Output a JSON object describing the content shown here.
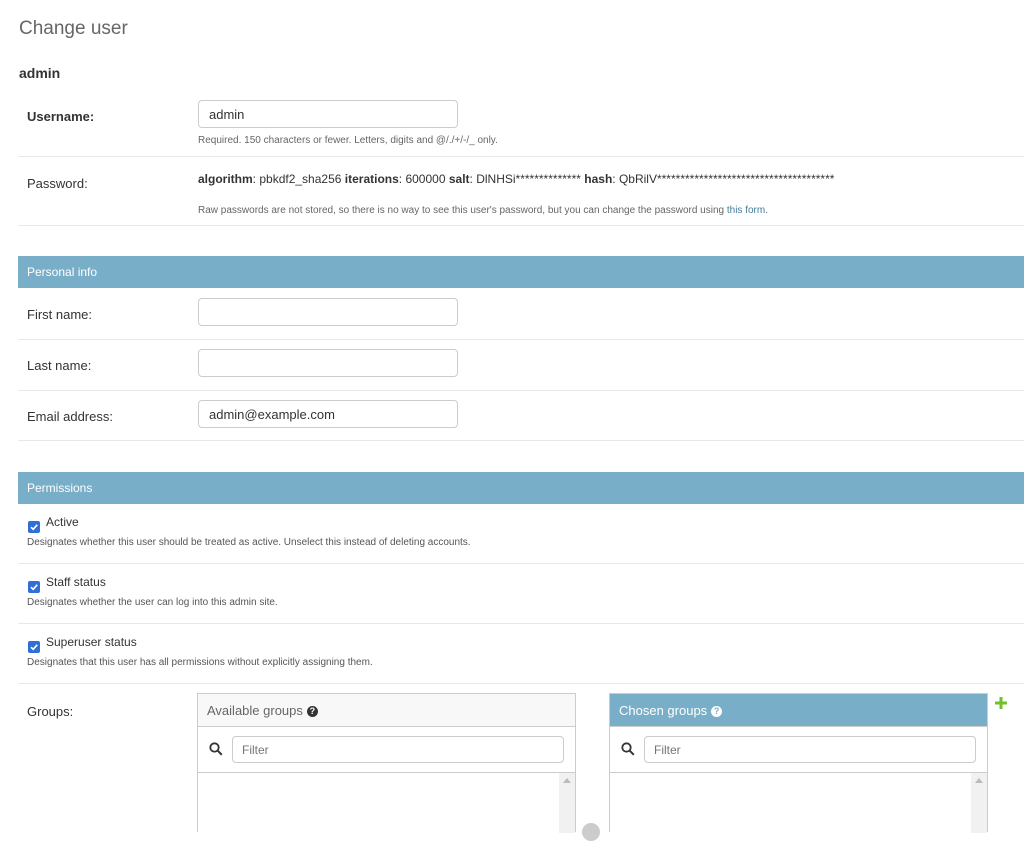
{
  "page_title": "Change user",
  "object_title": "admin",
  "fields": {
    "username": {
      "label": "Username:",
      "value": "admin",
      "help": "Required. 150 characters or fewer. Letters, digits and @/./+/-/_ only."
    },
    "password": {
      "label": "Password:",
      "algorithm_label": "algorithm",
      "algorithm_value": "pbkdf2_sha256",
      "iterations_label": "iterations",
      "iterations_value": "600000",
      "salt_label": "salt",
      "salt_value": "DlNHSi**************",
      "hash_label": "hash",
      "hash_value": "QbRilV**************************************",
      "help_prefix": "Raw passwords are not stored, so there is no way to see this user's password, but you can change the password using ",
      "help_link": "this form",
      "help_suffix": "."
    }
  },
  "personal_info": {
    "title": "Personal info",
    "first_name": {
      "label": "First name:",
      "value": ""
    },
    "last_name": {
      "label": "Last name:",
      "value": ""
    },
    "email": {
      "label": "Email address:",
      "value": "admin@example.com"
    }
  },
  "permissions": {
    "title": "Permissions",
    "active": {
      "label": "Active",
      "checked": true,
      "help": "Designates whether this user should be treated as active. Unselect this instead of deleting accounts."
    },
    "staff": {
      "label": "Staff status",
      "checked": true,
      "help": "Designates whether the user can log into this admin site."
    },
    "superuser": {
      "label": "Superuser status",
      "checked": true,
      "help": "Designates that this user has all permissions without explicitly assigning them."
    },
    "groups": {
      "label": "Groups:",
      "available_title": "Available groups",
      "chosen_title": "Chosen groups",
      "filter_placeholder": "Filter"
    }
  },
  "colors": {
    "section_header": "#79aec8",
    "link": "#447e9b",
    "checkbox": "#2f6fd6",
    "add_icon": "#70bf2b"
  },
  "icons": [
    "search-icon",
    "help-icon",
    "add-icon",
    "checkbox-check-icon"
  ]
}
